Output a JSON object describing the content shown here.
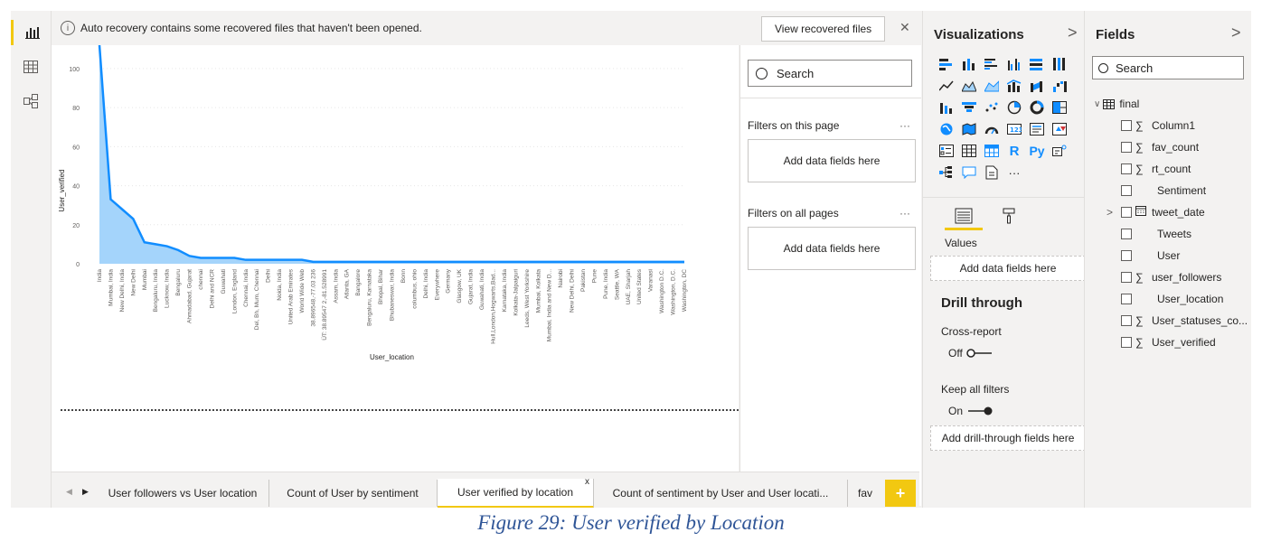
{
  "banner": {
    "info_icon": "info-icon",
    "message": "Auto recovery contains some recovered files that haven't been opened.",
    "button": "View recovered files",
    "close": "✕"
  },
  "filters": {
    "search": "Search",
    "on_page": "Filters on this page",
    "on_all": "Filters on all pages",
    "add_fields": "Add data fields here",
    "more": "···"
  },
  "tabs": {
    "items": [
      "User followers vs User location",
      "Count of User by sentiment",
      "User verified by location",
      "Count of sentiment by User and User locati...",
      "fav"
    ],
    "active_index": 2,
    "close": "x",
    "add": "+"
  },
  "visualizations": {
    "title": "Visualizations",
    "chevron": ">",
    "values_label": "Values",
    "add_fields": "Add data fields here",
    "drill_title": "Drill through",
    "cross_report": "Cross-report",
    "off": "Off",
    "keep_filters": "Keep all filters",
    "on": "On",
    "add_drill": "Add drill-through fields here",
    "r_label": "R",
    "py_label": "Py",
    "more": "···"
  },
  "fields": {
    "title": "Fields",
    "chevron": ">",
    "search": "Search",
    "table": "final",
    "items": [
      {
        "name": "Column1",
        "sigma": true
      },
      {
        "name": "fav_count",
        "sigma": true
      },
      {
        "name": "rt_count",
        "sigma": true
      },
      {
        "name": "Sentiment",
        "sigma": false
      },
      {
        "name": "tweet_date",
        "sigma": false,
        "calendar": true
      },
      {
        "name": "Tweets",
        "sigma": false
      },
      {
        "name": "User",
        "sigma": false
      },
      {
        "name": "user_followers",
        "sigma": true
      },
      {
        "name": "User_location",
        "sigma": false
      },
      {
        "name": "User_statuses_co...",
        "sigma": true
      },
      {
        "name": "User_verified",
        "sigma": true
      }
    ]
  },
  "chart_data": {
    "type": "area",
    "xlabel": "User_location",
    "ylabel": "User_verified",
    "yticks": [
      0,
      20,
      40,
      60,
      80,
      100
    ],
    "ylim": [
      0,
      112
    ],
    "categories": [
      "India",
      "Mumbai, India",
      "New Delhi, India",
      "New Delhi",
      "Mumbai",
      "Bengaluru, India",
      "Lucknow, India",
      "Bengaluru",
      "Ahmadabad, Gujarat",
      "chennai",
      "Delhi and NCR",
      "Guwahati",
      "London, England",
      "Chennai, India",
      "Del, Bh, Mum, Chennai",
      "Delhi",
      "Noida, India",
      "United Arab Emirates",
      "World Wide Web",
      "38.896548,-77.03 236",
      "ÜT: 38.89547 2,-81.528991",
      "Assam, India",
      "Atlanta, GA",
      "Bangalore",
      "Bengaluru, Karnataka",
      "Bhopal, Bihar",
      "Bhubaneswar, India",
      "Bonn",
      "columbus, ohio",
      "Delhi, India",
      "Everywhere",
      "Germany",
      "Glasgow, UK",
      "Gujarat, India",
      "Guwahati, India",
      "Hull,London,Hogwarts,Bad...",
      "Karnataka, India",
      "Kolkata-Jalpaiguri",
      "Leeds, West Yorkshire",
      "Mumbai, Kolkata",
      "Mumbai, India and New D...",
      "Nairobi",
      "New Delhi, Delhi",
      "Pakistan",
      "Pune",
      "Pune, India",
      "Seattle, WA",
      "UAE, Sharjah",
      "United States",
      "Varanasi",
      "Washington D.C.",
      "Washington, D.C.",
      "Washington, DC"
    ],
    "values": [
      112,
      33,
      28,
      23,
      11,
      10,
      9,
      7,
      4,
      3,
      3,
      3,
      3,
      2,
      2,
      2,
      2,
      2,
      2,
      1,
      1,
      1,
      1,
      1,
      1,
      1,
      1,
      1,
      1,
      1,
      1,
      1,
      1,
      1,
      1,
      1,
      1,
      1,
      1,
      1,
      1,
      1,
      1,
      1,
      1,
      1,
      1,
      1,
      1,
      1,
      1,
      1,
      1
    ],
    "line_color": "#118dff",
    "fill_color": "#a4d4fb"
  }
}
